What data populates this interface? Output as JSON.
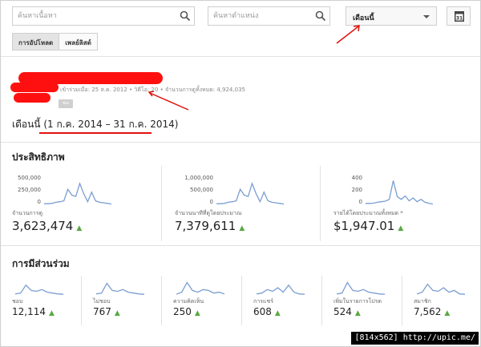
{
  "toolbar": {
    "content_search_placeholder": "ค้นหาเนื้อหา",
    "location_search_placeholder": "ค้นหาตำแหน่ง",
    "period_selected": "เดือนนี้",
    "calendar_day": "31",
    "tabs": [
      {
        "label": "การอัปโหลด",
        "active": true
      },
      {
        "label": "เพลย์ลิสต์",
        "active": false
      }
    ]
  },
  "channel": {
    "joined_label": "เข้าร่วมเมื่อ: 25 ส.ค. 2012",
    "videos_label": "วิดีโอ: 20",
    "total_views_label": "จำนวนการดูทั้งหมด: 4,924,035",
    "separator": "•",
    "badge_text": "ช่อง",
    "period_prefix": "เดือนนี้",
    "period_range": "(1 ก.ค. 2014 – 31 ก.ค. 2014)"
  },
  "performance": {
    "title": "ประสิทธิภาพ",
    "metrics": [
      {
        "label": "จำนวนการดู",
        "value": "3,623,474",
        "ticks": [
          "500,000",
          "250,000",
          "0"
        ],
        "spark": [
          0.05,
          0.05,
          0.06,
          0.1,
          0.12,
          0.15,
          0.55,
          0.35,
          0.3,
          0.75,
          0.4,
          0.12,
          0.45,
          0.15,
          0.1,
          0.08,
          0.06,
          0.04
        ]
      },
      {
        "label": "จำนวนนาทีที่ดูโดยประมาณ",
        "value": "7,379,611",
        "ticks": [
          "1,000,000",
          "500,000",
          "0"
        ],
        "spark": [
          0.05,
          0.05,
          0.06,
          0.1,
          0.12,
          0.15,
          0.55,
          0.35,
          0.3,
          0.75,
          0.4,
          0.12,
          0.45,
          0.15,
          0.1,
          0.08,
          0.06,
          0.04
        ]
      },
      {
        "label": "รายได้โดยประมาณทั้งหมด *",
        "value": "$1,947.01",
        "ticks": [
          "400",
          "200",
          "0"
        ],
        "spark": [
          0.06,
          0.06,
          0.07,
          0.1,
          0.12,
          0.14,
          0.2,
          0.85,
          0.3,
          0.2,
          0.32,
          0.15,
          0.25,
          0.12,
          0.2,
          0.1,
          0.06,
          0.04
        ]
      }
    ],
    "trend_color": "#5aa843",
    "spark_color": "#7b9ed1"
  },
  "engagement": {
    "title": "การมีส่วนร่วม",
    "metrics": [
      {
        "label": "ชอบ",
        "value": "12,114",
        "spark": [
          0.1,
          0.15,
          0.6,
          0.3,
          0.25,
          0.35,
          0.2,
          0.15,
          0.1,
          0.08
        ]
      },
      {
        "label": "ไม่ชอบ",
        "value": "767",
        "spark": [
          0.1,
          0.15,
          0.7,
          0.3,
          0.25,
          0.35,
          0.2,
          0.15,
          0.1,
          0.08
        ]
      },
      {
        "label": "ความคิดเห็น",
        "value": "250",
        "spark": [
          0.08,
          0.2,
          0.75,
          0.3,
          0.2,
          0.35,
          0.3,
          0.15,
          0.2,
          0.1
        ]
      },
      {
        "label": "การแชร์",
        "value": "608",
        "spark": [
          0.1,
          0.15,
          0.35,
          0.25,
          0.45,
          0.2,
          0.6,
          0.2,
          0.1,
          0.08
        ]
      },
      {
        "label": "เพิ่มในรายการโปรด",
        "value": "524",
        "spark": [
          0.1,
          0.15,
          0.75,
          0.3,
          0.25,
          0.35,
          0.2,
          0.15,
          0.1,
          0.08
        ]
      },
      {
        "label": "สมาชิก",
        "value": "7,562",
        "spark": [
          0.1,
          0.2,
          0.65,
          0.3,
          0.25,
          0.45,
          0.2,
          0.3,
          0.1,
          0.08
        ]
      }
    ]
  },
  "watermark": "[814x562] http://upic.me/",
  "annotation_color": "#e0120f"
}
